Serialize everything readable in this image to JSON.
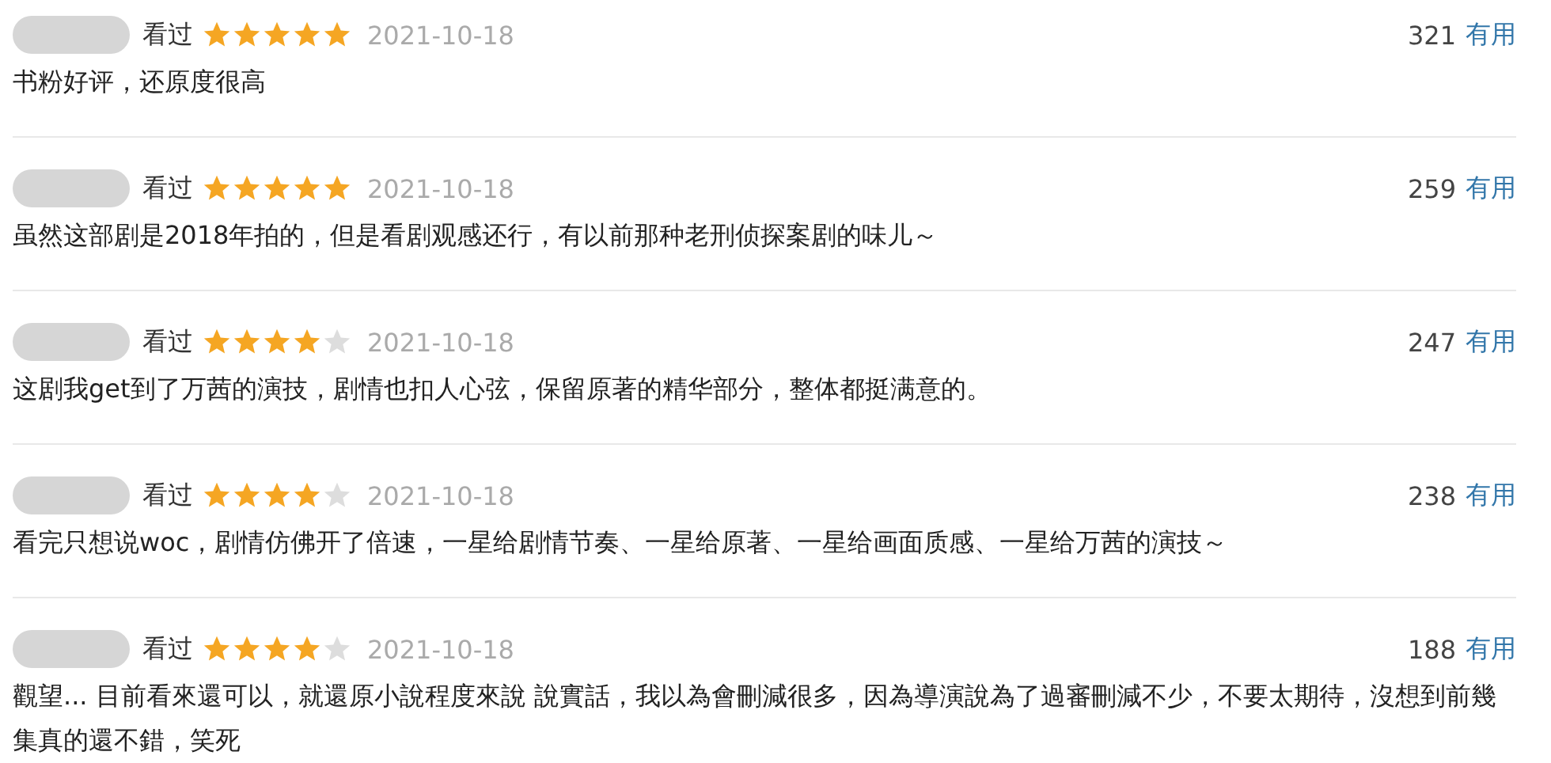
{
  "reviews": [
    {
      "status": "看过",
      "stars": 5,
      "date": "2021-10-18",
      "votes": "321",
      "useful": "有用",
      "text": "书粉好评，还原度很高"
    },
    {
      "status": "看过",
      "stars": 5,
      "date": "2021-10-18",
      "votes": "259",
      "useful": "有用",
      "text": "虽然这部剧是2018年拍的，但是看剧观感还行，有以前那种老刑侦探案剧的味儿～"
    },
    {
      "status": "看过",
      "stars": 4,
      "date": "2021-10-18",
      "votes": "247",
      "useful": "有用",
      "text": "这剧我get到了万茜的演技，剧情也扣人心弦，保留原著的精华部分，整体都挺满意的。"
    },
    {
      "status": "看过",
      "stars": 4,
      "date": "2021-10-18",
      "votes": "238",
      "useful": "有用",
      "text": "看完只想说woc，剧情仿佛开了倍速，一星给剧情节奏、一星给原著、一星给画面质感、一星给万茜的演技～"
    },
    {
      "status": "看过",
      "stars": 4,
      "date": "2021-10-18",
      "votes": "188",
      "useful": "有用",
      "text": "觀望... 目前看來還可以，就還原小說程度來說 說實話，我以為會刪減很多，因為導演說為了過審刪減不少，不要太期待，沒想到前幾集真的還不錯，笑死"
    }
  ]
}
